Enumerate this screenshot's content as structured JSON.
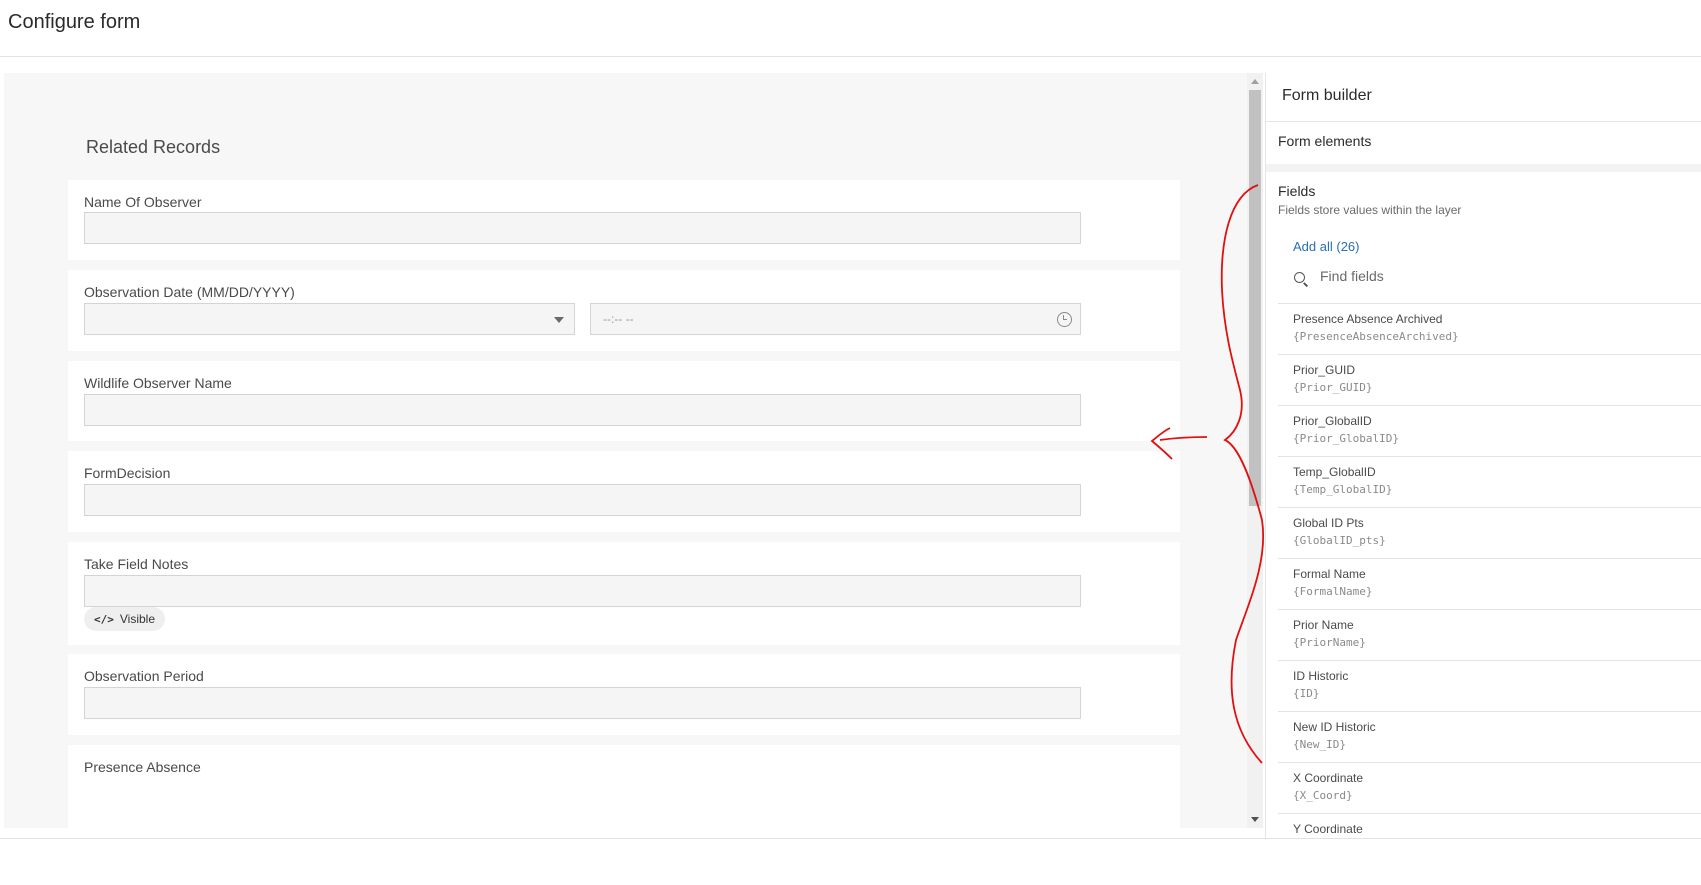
{
  "header": {
    "title": "Configure form"
  },
  "preview": {
    "section_heading": "Related Records",
    "cards": [
      {
        "label": "Name Of Observer"
      },
      {
        "label": "Observation Date (MM/DD/YYYY)",
        "time_placeholder": "--:-- --"
      },
      {
        "label": "Wildlife Observer Name"
      },
      {
        "label": "FormDecision"
      },
      {
        "label": "Take Field Notes",
        "chip_code": "</>",
        "chip_label": "Visible"
      },
      {
        "label": "Observation Period"
      },
      {
        "label": "Presence Absence"
      }
    ]
  },
  "panel": {
    "title": "Form builder",
    "form_elements": "Form elements",
    "fields_title": "Fields",
    "fields_subtitle": "Fields store values within the layer",
    "add_all": "Add all (26)",
    "search_placeholder": "Find fields",
    "fields": [
      {
        "name": "Presence Absence Archived",
        "key": "{PresenceAbsenceArchived}"
      },
      {
        "name": "Prior_GUID",
        "key": "{Prior_GUID}"
      },
      {
        "name": "Prior_GlobalID",
        "key": "{Prior_GlobalID}"
      },
      {
        "name": "Temp_GlobalID",
        "key": "{Temp_GlobalID}"
      },
      {
        "name": "Global ID Pts",
        "key": "{GlobalID_pts}"
      },
      {
        "name": "Formal Name",
        "key": "{FormalName}"
      },
      {
        "name": "Prior Name",
        "key": "{PriorName}"
      },
      {
        "name": "ID Historic",
        "key": "{ID}"
      },
      {
        "name": "New ID Historic",
        "key": "{New_ID}"
      },
      {
        "name": "X Coordinate",
        "key": "{X_Coord}"
      },
      {
        "name": "Y Coordinate",
        "key": ""
      }
    ]
  },
  "colors": {
    "accent_link": "#2a6fb0",
    "annotation": "#e01010"
  }
}
